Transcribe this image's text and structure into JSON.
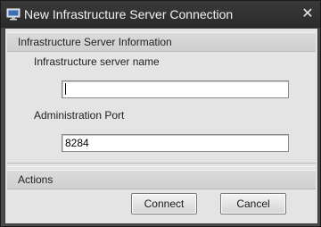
{
  "window": {
    "title": "New Infrastructure Server Connection",
    "close_glyph": "✕",
    "app_icon": "monitor-icon"
  },
  "info_section": {
    "header": "Infrastructure Server Information",
    "server_name_label": "Infrastructure server name",
    "server_name_value": "",
    "port_label": "Administration Port",
    "port_value": "8284"
  },
  "actions_section": {
    "header": "Actions",
    "connect_label": "Connect",
    "cancel_label": "Cancel"
  },
  "colors": {
    "titlebar": "#2f2f2f",
    "client_bg": "#e4e4e4",
    "header_bg": "#d4d4d4"
  }
}
